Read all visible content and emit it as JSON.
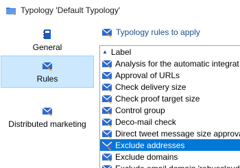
{
  "window": {
    "title": "Typology 'Default Typology'"
  },
  "nav": {
    "items": [
      {
        "id": "general",
        "label": "General",
        "icon": "notebook-icon",
        "selected": false
      },
      {
        "id": "rules",
        "label": "Rules",
        "icon": "envelope-rules-icon",
        "selected": true
      },
      {
        "id": "distributed",
        "label": "Distributed marketing",
        "icon": "envelope-rules-icon",
        "selected": false
      }
    ]
  },
  "panel": {
    "header_label": "Typology rules to apply",
    "list": {
      "column_label": "Label",
      "sort": "ascending",
      "rows": [
        {
          "label": "Analysis for the automatic integrat",
          "selected": false
        },
        {
          "label": "Approval of URLs",
          "selected": false
        },
        {
          "label": "Check delivery size",
          "selected": false
        },
        {
          "label": "Check proof target size",
          "selected": false
        },
        {
          "label": "Control group",
          "selected": false
        },
        {
          "label": "Deco-mail check",
          "selected": false
        },
        {
          "label": "Direct tweet message size approval",
          "selected": false
        },
        {
          "label": "Exclude addresses",
          "selected": true
        },
        {
          "label": "Exclude domains",
          "selected": false
        },
        {
          "label": "Exclude email domain 'rebuscloud",
          "selected": false
        }
      ]
    }
  },
  "colors": {
    "selection": "#0078d7",
    "nav_selection": "#cce8ff",
    "header_text": "#1f4e8c"
  }
}
